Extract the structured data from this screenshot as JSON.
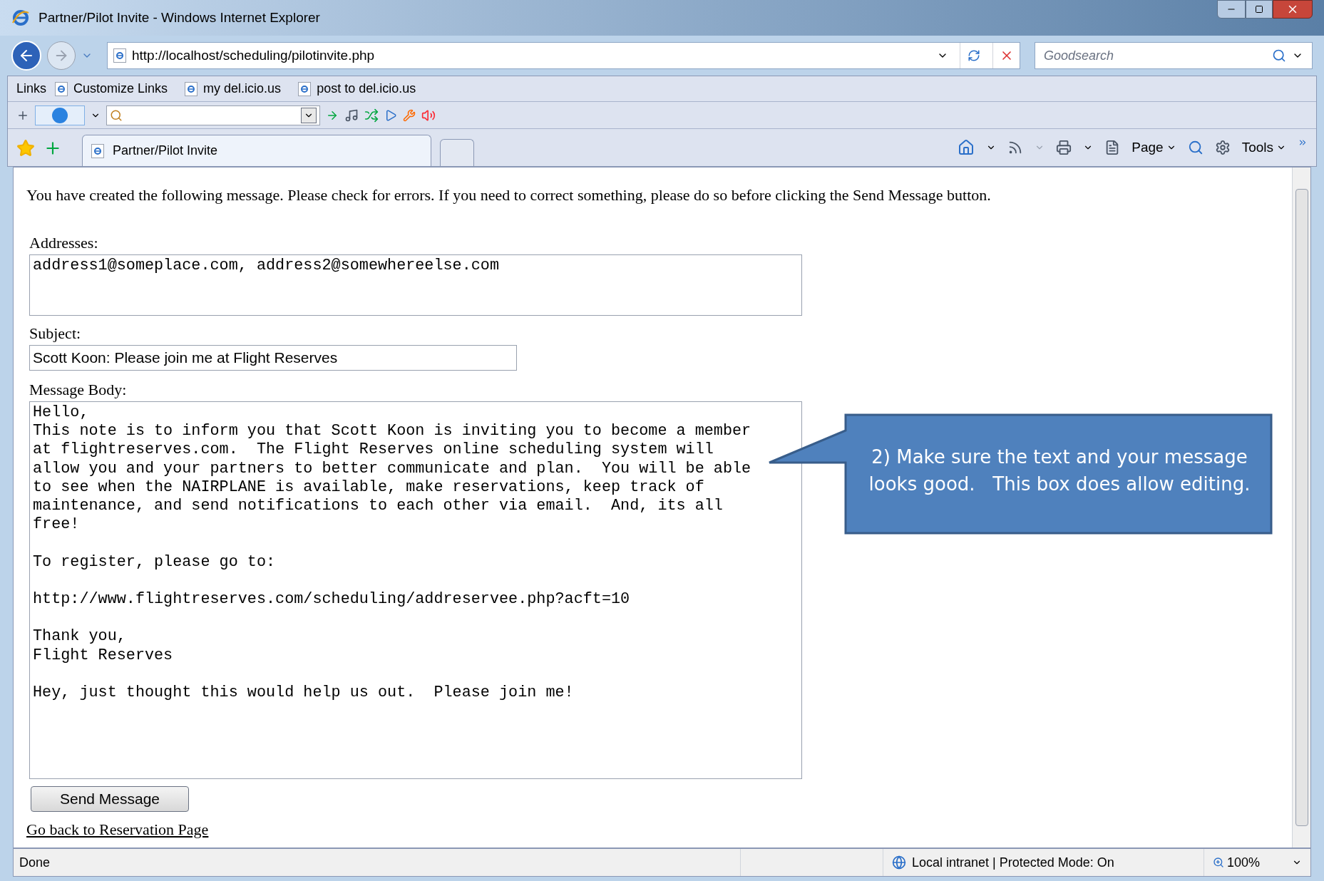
{
  "window": {
    "title": "Partner/Pilot Invite - Windows Internet Explorer"
  },
  "address_bar": {
    "url": "http://localhost/scheduling/pilotinvite.php"
  },
  "search": {
    "placeholder": "Goodsearch"
  },
  "links_bar": {
    "label": "Links",
    "items": [
      "Customize Links",
      "my del.icio.us",
      "post to del.icio.us"
    ]
  },
  "tab": {
    "title": "Partner/Pilot Invite"
  },
  "command_bar": {
    "items": [
      "Page",
      "Tools"
    ]
  },
  "page": {
    "intro": "You have created the following message. Please check for errors. If you need to correct something, please do so before clicking the Send Message button.",
    "addresses": {
      "label": "Addresses:",
      "value": "address1@someplace.com, address2@somewhereelse.com"
    },
    "subject": {
      "label": "Subject:",
      "value": "Scott Koon: Please join me at Flight Reserves"
    },
    "body": {
      "label": "Message Body:",
      "value": "Hello,\nThis note is to inform you that Scott Koon is inviting you to become a member\nat flightreserves.com.  The Flight Reserves online scheduling system will\nallow you and your partners to better communicate and plan.  You will be able\nto see when the NAIRPLANE is available, make reservations, keep track of\nmaintenance, and send notifications to each other via email.  And, its all\nfree!\n\nTo register, please go to:\n\nhttp://www.flightreserves.com/scheduling/addreservee.php?acft=10\n\nThank you,\nFlight Reserves\n\nHey, just thought this would help us out.  Please join me!"
    },
    "send_button": "Send Message",
    "back_link": "Go back to Reservation Page"
  },
  "callout": {
    "lines": [
      "2) Make sure the text and your message",
      "looks good.   This box does allow editing."
    ]
  },
  "status_bar": {
    "status": "Done",
    "zone": "Local intranet | Protected Mode: On",
    "zoom": "100%"
  }
}
